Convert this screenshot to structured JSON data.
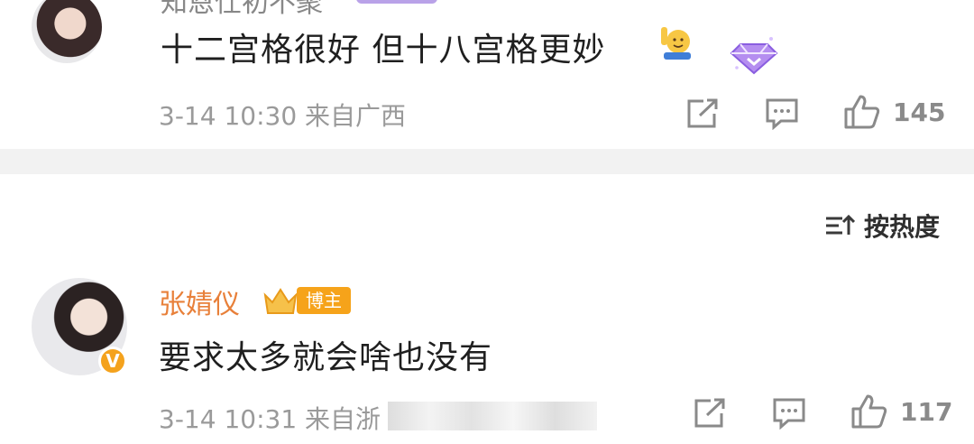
{
  "comments": [
    {
      "username": "知恩仕初不聚",
      "text": "十二宫格很好 但十八宫格更妙",
      "emoji": "raising-hand-emoji",
      "time": "3-14 10:30",
      "location": "来自广西",
      "likes": "145",
      "badge_icon": "purple-gem-icon"
    },
    {
      "username": "张婧仪",
      "author_badge": "博主",
      "text": "要求太多就会啥也没有",
      "time": "3-14 10:31",
      "location": "来自浙",
      "likes": "117",
      "verified": "V"
    }
  ],
  "sort": {
    "label": "按热度",
    "icon": "sort-icon"
  },
  "colors": {
    "accent": "#e8803a",
    "badge": "#f6a31a",
    "meta": "#9a9a9a",
    "text": "#1f1f1f"
  }
}
